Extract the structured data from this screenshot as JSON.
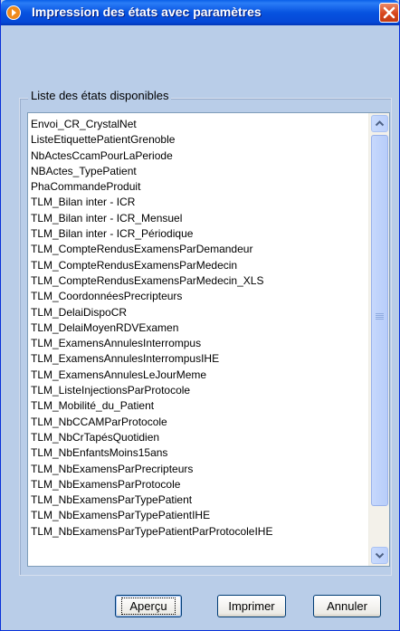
{
  "window": {
    "title": "Impression des états avec paramètres",
    "icon": "app-icon",
    "close_icon": "close-icon"
  },
  "groupbox": {
    "label": "Liste des états disponibles"
  },
  "list": {
    "items": [
      "Envoi_CR_CrystalNet",
      "ListeEtiquettePatientGrenoble",
      "NbActesCcamPourLaPeriode",
      "NBActes_TypePatient",
      "PhaCommandeProduit",
      "TLM_Bilan inter - ICR",
      "TLM_Bilan inter - ICR_Mensuel",
      "TLM_Bilan inter - ICR_Périodique",
      "TLM_CompteRendusExamensParDemandeur",
      "TLM_CompteRendusExamensParMedecin",
      "TLM_CompteRendusExamensParMedecin_XLS",
      "TLM_CoordonnéesPrecripteurs",
      "TLM_DelaiDispoCR",
      "TLM_DelaiMoyenRDVExamen",
      "TLM_ExamensAnnulesInterrompus",
      "TLM_ExamensAnnulesInterrompusIHE",
      "TLM_ExamensAnnulesLeJourMeme",
      "TLM_ListeInjectionsParProtocole",
      "TLM_Mobilité_du_Patient",
      "TLM_NbCCAMParProtocole",
      "TLM_NbCrTapésQuotidien",
      "TLM_NbEnfantsMoins15ans",
      "TLM_NbExamensParPrecripteurs",
      "TLM_NbExamensParProtocole",
      "TLM_NbExamensParTypePatient",
      "TLM_NbExamensParTypePatientIHE",
      "TLM_NbExamensParTypePatientParProtocoleIHE"
    ]
  },
  "buttons": {
    "preview": "Aperçu",
    "print": "Imprimer",
    "cancel": "Annuler"
  },
  "colors": {
    "titlebar": "#0753e0",
    "window_bg": "#b9cde8",
    "close_button": "#d8461c"
  }
}
